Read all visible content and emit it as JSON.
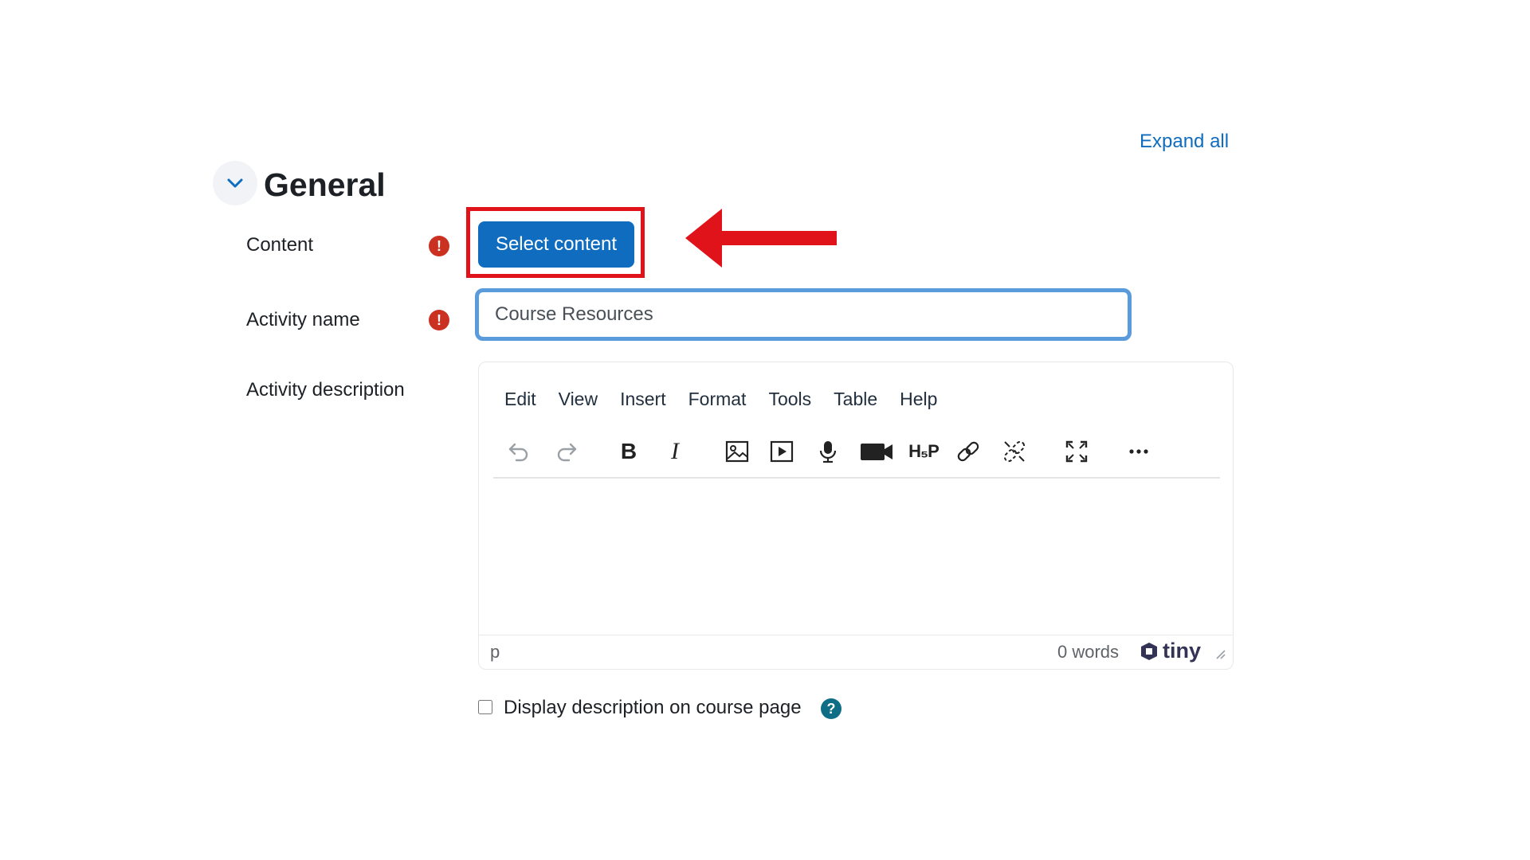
{
  "header": {
    "expand_all": "Expand all"
  },
  "section": {
    "title": "General",
    "toggle_icon": "chevron-down-icon"
  },
  "fields": {
    "content": {
      "label": "Content",
      "required_icon": "exclamation-circle-icon",
      "button_label": "Select content"
    },
    "activity_name": {
      "label": "Activity name",
      "required_icon": "exclamation-circle-icon",
      "value": "Course Resources"
    },
    "activity_description": {
      "label": "Activity description"
    }
  },
  "editor": {
    "menu": [
      "Edit",
      "View",
      "Insert",
      "Format",
      "Tools",
      "Table",
      "Help"
    ],
    "toolbar": [
      "undo-icon",
      "redo-icon",
      "bold-icon",
      "italic-icon",
      "image-icon",
      "media-icon",
      "microphone-icon",
      "video-camera-icon",
      "h5p-icon",
      "link-icon",
      "unlink-icon",
      "fullscreen-icon",
      "more-icon"
    ],
    "status_path": "p",
    "word_count": "0 words",
    "brand": "tiny"
  },
  "display_description": {
    "label": "Display description on course page",
    "checked": false,
    "help_icon": "question-circle-icon"
  },
  "annotation": {
    "highlight_color": "#e0131a",
    "arrow_color": "#e0131a"
  },
  "colors": {
    "primary": "#0f6cbf",
    "required": "#ca3120",
    "help": "#0f6e85"
  }
}
